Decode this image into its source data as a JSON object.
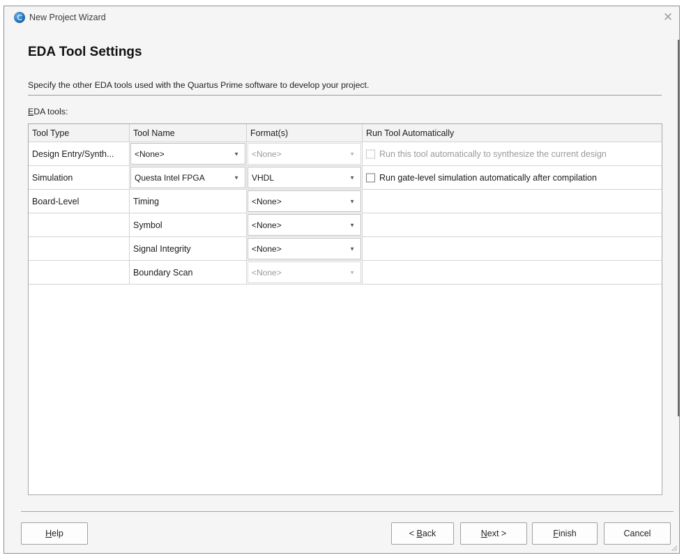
{
  "window": {
    "title": "New Project Wizard",
    "icon": "quartus-app-icon",
    "close_glyph": "✕"
  },
  "page": {
    "heading": "EDA Tool Settings",
    "description": "Specify the other EDA tools used with the Quartus Prime software to develop your project.",
    "tools_label_mnemonic": "E",
    "tools_label_rest": "DA tools:"
  },
  "table": {
    "headers": [
      "Tool Type",
      "Tool Name",
      "Format(s)",
      "Run Tool Automatically"
    ],
    "rows": [
      {
        "tool_type": "Design Entry/Synth...",
        "tool_name": "<None>",
        "tool_name_combo": true,
        "tool_name_enabled": true,
        "format": "<None>",
        "format_enabled": false,
        "run_label": "Run this tool automatically to synthesize the current design",
        "run_enabled": false,
        "run_checked": false
      },
      {
        "tool_type": "Simulation",
        "tool_name": "Questa Intel FPGA",
        "tool_name_combo": true,
        "tool_name_enabled": true,
        "format": "VHDL",
        "format_enabled": true,
        "run_label": "Run gate-level simulation automatically after compilation",
        "run_enabled": true,
        "run_checked": false
      },
      {
        "tool_type": "Board-Level",
        "tool_name": "Timing",
        "tool_name_combo": false,
        "format": "<None>",
        "format_enabled": true
      },
      {
        "tool_type": "",
        "tool_name": "Symbol",
        "tool_name_combo": false,
        "format": "<None>",
        "format_enabled": true
      },
      {
        "tool_type": "",
        "tool_name": "Signal Integrity",
        "tool_name_combo": false,
        "format": "<None>",
        "format_enabled": true
      },
      {
        "tool_type": "",
        "tool_name": "Boundary Scan",
        "tool_name_combo": false,
        "format": "<None>",
        "format_enabled": false
      }
    ]
  },
  "buttons": {
    "help": {
      "mnemonic": "H",
      "rest": "elp"
    },
    "back": {
      "prefix": "< ",
      "mnemonic": "B",
      "rest": "ack"
    },
    "next": {
      "prefix": "",
      "mnemonic": "N",
      "rest": "ext >"
    },
    "finish": {
      "mnemonic": "F",
      "rest": "inish"
    },
    "cancel": "Cancel"
  },
  "colors": {
    "window_bg": "#f5f5f5",
    "table_bg": "#ffffff",
    "disabled_text": "#9a9a9a"
  }
}
